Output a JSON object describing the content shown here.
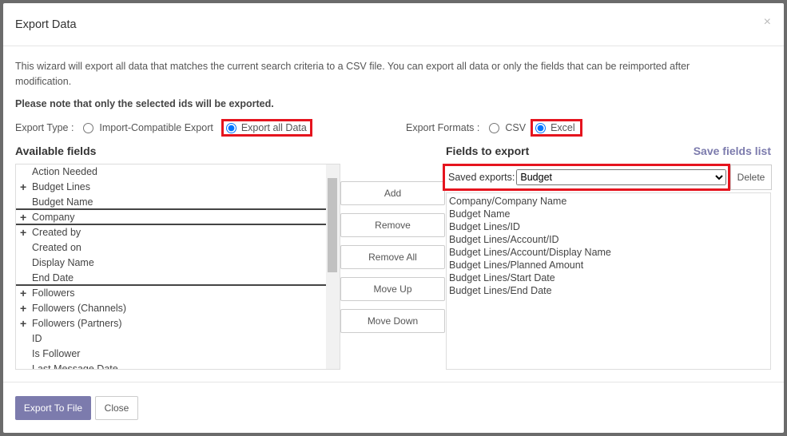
{
  "dialog": {
    "title": "Export Data",
    "close_icon": "×"
  },
  "intro": "This wizard will export all data that matches the current search criteria to a CSV file. You can export all data or only the fields that can be reimported after modification.",
  "note": "Please note that only the selected ids will be exported.",
  "export_type": {
    "label": "Export Type :",
    "options": [
      "Import-Compatible Export",
      "Export all Data"
    ],
    "selected": "Export all Data"
  },
  "export_formats": {
    "label": "Export Formats :",
    "options": [
      "CSV",
      "Excel"
    ],
    "selected": "Excel"
  },
  "available": {
    "heading": "Available fields",
    "items": [
      {
        "label": "Action Needed",
        "expandable": false
      },
      {
        "label": "Budget Lines",
        "expandable": true
      },
      {
        "label": "Budget Name",
        "expandable": false
      },
      {
        "label": "Company",
        "expandable": true
      },
      {
        "label": "Created by",
        "expandable": true
      },
      {
        "label": "Created on",
        "expandable": false
      },
      {
        "label": "Display Name",
        "expandable": false
      },
      {
        "label": "End Date",
        "expandable": false
      },
      {
        "label": "Followers",
        "expandable": true
      },
      {
        "label": "Followers (Channels)",
        "expandable": true
      },
      {
        "label": "Followers (Partners)",
        "expandable": true
      },
      {
        "label": "ID",
        "expandable": false
      },
      {
        "label": "Is Follower",
        "expandable": false
      },
      {
        "label": "Last Message Date",
        "expandable": false
      }
    ]
  },
  "actions": {
    "add": "Add",
    "remove": "Remove",
    "remove_all": "Remove All",
    "move_up": "Move Up",
    "move_down": "Move Down"
  },
  "export": {
    "heading": "Fields to export",
    "save_link": "Save fields list",
    "saved_label": "Saved exports:",
    "saved_value": "Budget",
    "delete": "Delete",
    "items": [
      "Company/Company Name",
      "Budget Name",
      "Budget Lines/ID",
      "Budget Lines/Account/ID",
      "Budget Lines/Account/Display Name",
      "Budget Lines/Planned Amount",
      "Budget Lines/Start Date",
      "Budget Lines/End Date"
    ]
  },
  "footer": {
    "export_btn": "Export To File",
    "close_btn": "Close"
  },
  "colors": {
    "primary": "#7c7bad",
    "highlight": "#e5141e"
  }
}
